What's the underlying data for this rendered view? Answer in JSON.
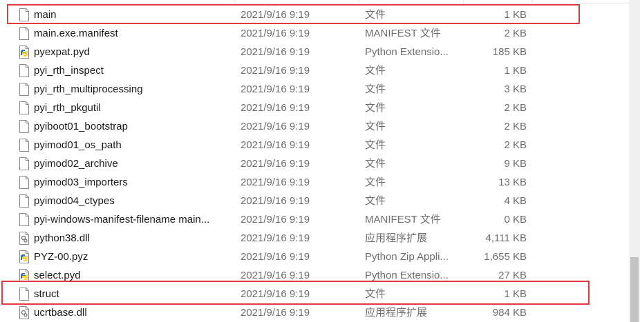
{
  "files": [
    {
      "name": "main",
      "date": "2021/9/16 9:19",
      "type": "文件",
      "size": "1 KB",
      "icon": "blank-file-icon"
    },
    {
      "name": "main.exe.manifest",
      "date": "2021/9/16 9:19",
      "type": "MANIFEST 文件",
      "size": "2 KB",
      "icon": "blank-file-icon"
    },
    {
      "name": "pyexpat.pyd",
      "date": "2021/9/16 9:19",
      "type": "Python Extensio...",
      "size": "185 KB",
      "icon": "python-file-icon"
    },
    {
      "name": "pyi_rth_inspect",
      "date": "2021/9/16 9:19",
      "type": "文件",
      "size": "1 KB",
      "icon": "blank-file-icon"
    },
    {
      "name": "pyi_rth_multiprocessing",
      "date": "2021/9/16 9:19",
      "type": "文件",
      "size": "3 KB",
      "icon": "blank-file-icon"
    },
    {
      "name": "pyi_rth_pkgutil",
      "date": "2021/9/16 9:19",
      "type": "文件",
      "size": "2 KB",
      "icon": "blank-file-icon"
    },
    {
      "name": "pyiboot01_bootstrap",
      "date": "2021/9/16 9:19",
      "type": "文件",
      "size": "2 KB",
      "icon": "blank-file-icon"
    },
    {
      "name": "pyimod01_os_path",
      "date": "2021/9/16 9:19",
      "type": "文件",
      "size": "2 KB",
      "icon": "blank-file-icon"
    },
    {
      "name": "pyimod02_archive",
      "date": "2021/9/16 9:19",
      "type": "文件",
      "size": "9 KB",
      "icon": "blank-file-icon"
    },
    {
      "name": "pyimod03_importers",
      "date": "2021/9/16 9:19",
      "type": "文件",
      "size": "13 KB",
      "icon": "blank-file-icon"
    },
    {
      "name": "pyimod04_ctypes",
      "date": "2021/9/16 9:19",
      "type": "文件",
      "size": "4 KB",
      "icon": "blank-file-icon"
    },
    {
      "name": "pyi-windows-manifest-filename main...",
      "date": "2021/9/16 9:19",
      "type": "MANIFEST 文件",
      "size": "0 KB",
      "icon": "blank-file-icon"
    },
    {
      "name": "python38.dll",
      "date": "2021/9/16 9:19",
      "type": "应用程序扩展",
      "size": "4,111 KB",
      "icon": "dll-file-icon"
    },
    {
      "name": "PYZ-00.pyz",
      "date": "2021/9/16 9:19",
      "type": "Python Zip Appli...",
      "size": "1,655 KB",
      "icon": "python-file-icon"
    },
    {
      "name": "select.pyd",
      "date": "2021/9/16 9:19",
      "type": "Python Extensio...",
      "size": "27 KB",
      "icon": "python-file-icon"
    },
    {
      "name": "struct",
      "date": "2021/9/16 9:19",
      "type": "文件",
      "size": "1 KB",
      "icon": "blank-file-icon"
    },
    {
      "name": "ucrtbase.dll",
      "date": "2021/9/16 9:19",
      "type": "应用程序扩展",
      "size": "984 KB",
      "icon": "dll-file-icon"
    }
  ],
  "colors": {
    "highlight": "#e0393e",
    "secondary_text": "#6d6d6d",
    "python_blue": "#3776ab",
    "python_yellow": "#ffd43b"
  }
}
